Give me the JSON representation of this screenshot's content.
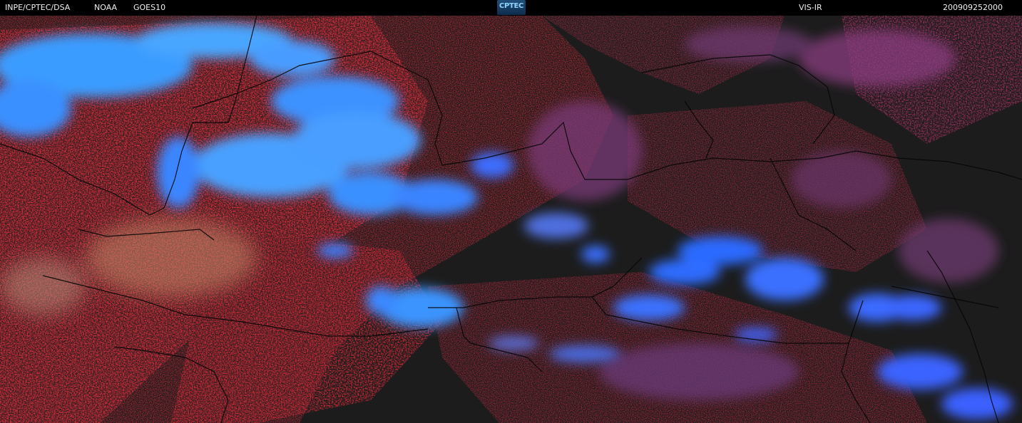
{
  "header": {
    "source": "INPE/CPTEC/DSA",
    "agency": "NOAA",
    "satellite": "GOES10",
    "logo_text": "CPTEC",
    "product": "VIS-IR",
    "timestamp": "200909252000"
  },
  "colors": {
    "header_bg": "#000000",
    "header_text": "#f0f0f0",
    "clear_ground": "#1c1c1c",
    "low_cloud_red": "#c42a38",
    "high_cloud_blue": "#3a8dff",
    "mid_cloud_purple": "#7a3a78",
    "boundary_line": "#000000"
  },
  "map": {
    "type": "satellite-image",
    "composite": "VIS-IR"
  }
}
